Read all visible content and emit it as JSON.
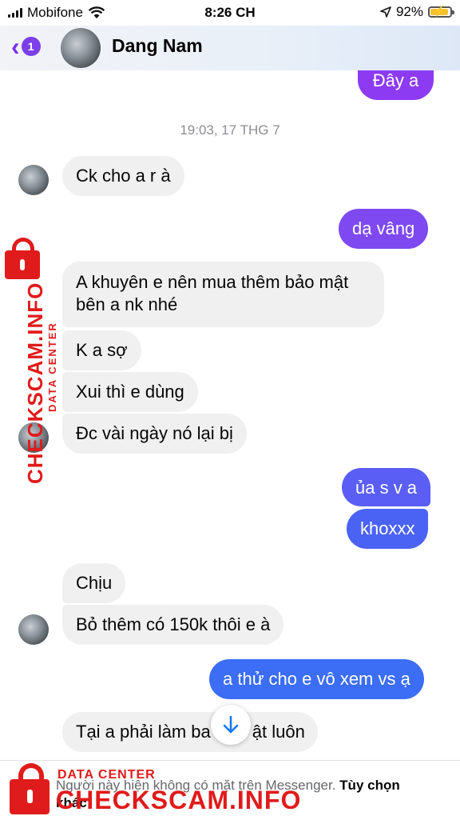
{
  "status_bar": {
    "carrier": "Mobifone",
    "time": "8:26 CH",
    "battery": "92%",
    "battery_level": 0.92
  },
  "header": {
    "unread_count": "1",
    "contact_name": "Dang Nam"
  },
  "colors": {
    "purple": "#8a3cf0",
    "blue": "#3b6df5",
    "incoming_bg": "#f0f0f0",
    "accent": "#7b2ff0",
    "watermark": "#e01b1b"
  },
  "messages": {
    "timestamp": "19:03, 17 THG 7",
    "m0": "Đây a",
    "m1": "Ck cho a r à",
    "m2": "dạ vâng",
    "m3": "A khuyên e nên mua thêm bảo mật bên a nk nhé",
    "m4": "K a sợ",
    "m5": "Xui thì e dùng",
    "m6": "Đc vài ngày nó lại bị",
    "m7": "ủa s v a",
    "m8": "khoxxx",
    "m9": "Chịu",
    "m10": "Bỏ thêm có 150k thôi e à",
    "m11": "a thử cho e vô xem vs ạ",
    "m12": "Tại a phải làm ba",
    "m12_tail": "ật luôn"
  },
  "footer": {
    "notice": "Người này hiện không có mặt trên Messenger.",
    "action": "Tùy chọn khác"
  },
  "watermark": {
    "label": "DATA CENTER",
    "brand": "CHECKSCAM.INFO"
  }
}
